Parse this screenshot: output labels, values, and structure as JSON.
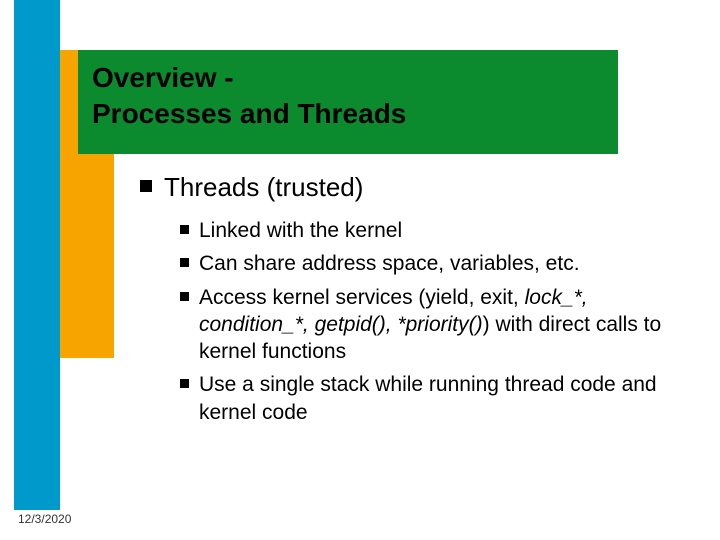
{
  "title_line1": "Overview -",
  "title_line2": "Processes and Threads",
  "main_bullet": "Threads (trusted)",
  "sub_bullets": {
    "b0": "Linked with the kernel",
    "b1": "Can share address space, variables, etc.",
    "b2_prefix": "Access kernel services (yield, exit, ",
    "b2_italic1": "lock_*, condition_*, getpid(), *priority()",
    "b2_suffix": ") with direct calls to kernel functions",
    "b3": "Use a single stack while running thread code and kernel code"
  },
  "footer_date": "12/3/2020"
}
